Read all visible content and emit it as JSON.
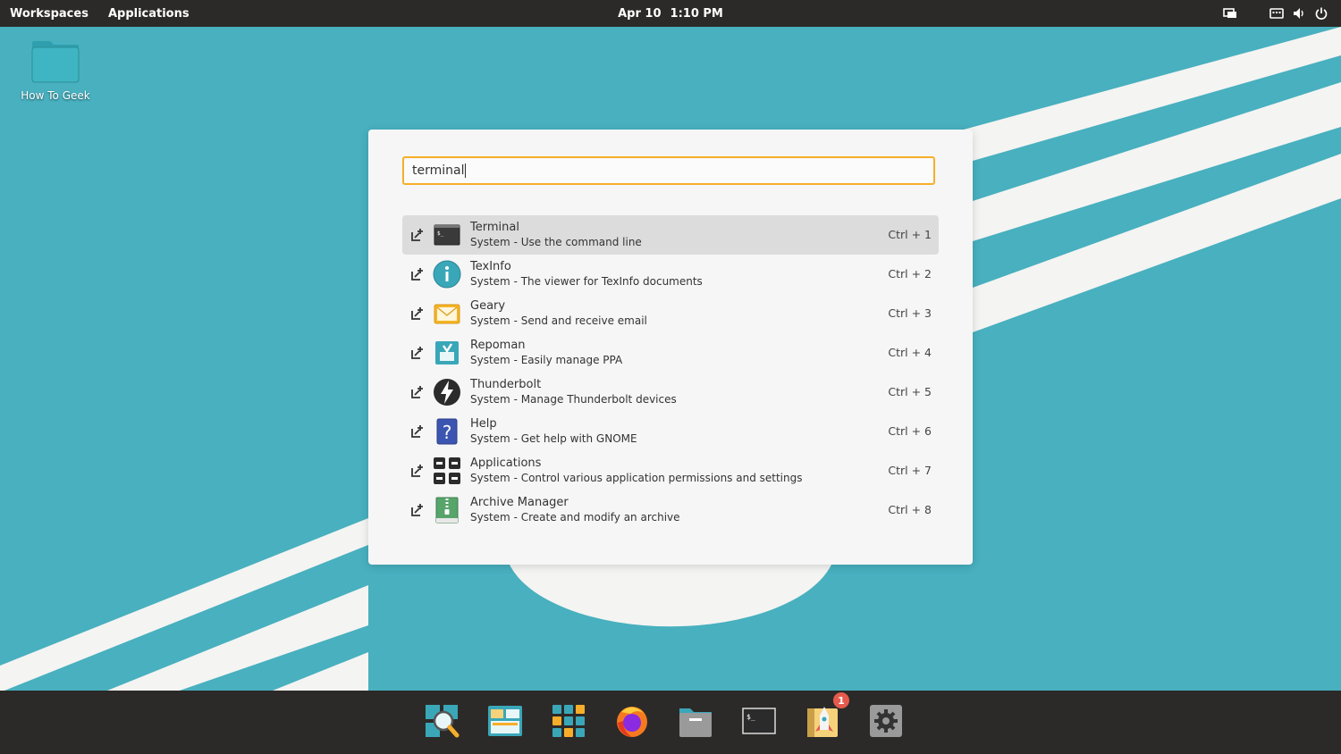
{
  "topbar": {
    "workspaces": "Workspaces",
    "applications": "Applications",
    "date": "Apr 10",
    "time": "1:10 PM",
    "tray_icons": [
      "display-icon",
      "keyboard-icon",
      "volume-icon",
      "power-icon"
    ]
  },
  "desktop": {
    "folder_label": "How To Geek"
  },
  "launcher": {
    "query": "terminal",
    "results": [
      {
        "title": "Terminal",
        "desc": "System - Use the command line",
        "shortcut": "Ctrl + 1",
        "icon": "terminal-icon",
        "selected": true
      },
      {
        "title": "TexInfo",
        "desc": "System - The viewer for TexInfo documents",
        "shortcut": "Ctrl + 2",
        "icon": "info-icon"
      },
      {
        "title": "Geary",
        "desc": "System - Send and receive email",
        "shortcut": "Ctrl + 3",
        "icon": "mail-icon"
      },
      {
        "title": "Repoman",
        "desc": "System - Easily manage PPA",
        "shortcut": "Ctrl + 4",
        "icon": "repoman-icon"
      },
      {
        "title": "Thunderbolt",
        "desc": "System - Manage Thunderbolt devices",
        "shortcut": "Ctrl + 5",
        "icon": "thunderbolt-icon"
      },
      {
        "title": "Help",
        "desc": "System - Get help with GNOME",
        "shortcut": "Ctrl + 6",
        "icon": "help-icon"
      },
      {
        "title": "Applications",
        "desc": "System - Control various application permissions and settings",
        "shortcut": "Ctrl + 7",
        "icon": "applications-grid-icon"
      },
      {
        "title": "Archive Manager",
        "desc": "System - Create and modify an archive",
        "shortcut": "Ctrl + 8",
        "icon": "archive-icon"
      }
    ]
  },
  "dock": {
    "items": [
      "launcher-search-icon",
      "workspaces-icon",
      "app-library-icon",
      "firefox-icon",
      "files-icon",
      "terminal-icon",
      "pop-shop-icon",
      "settings-icon"
    ],
    "shop_badge": "1"
  },
  "colors": {
    "wallpaper": "#48b0bf",
    "panel": "#2c2a28",
    "accent": "#f6ae2a",
    "selected_row": "#dcdcdc",
    "badge": "#e65a4d"
  }
}
